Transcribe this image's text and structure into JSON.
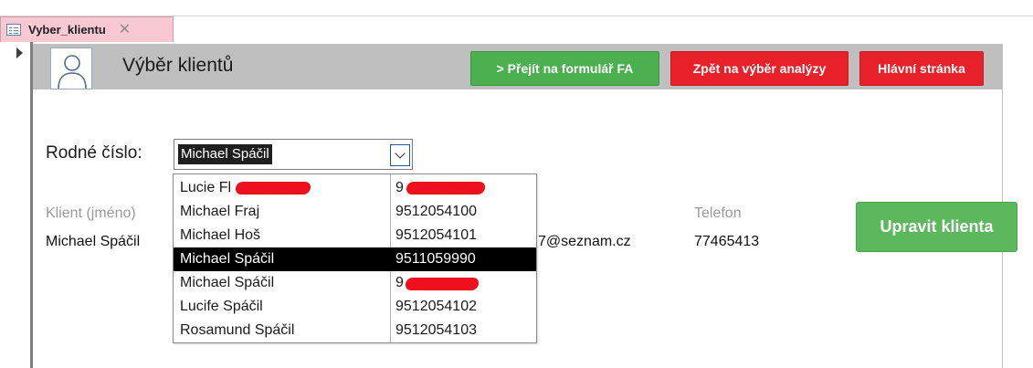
{
  "tab": {
    "title": "Vyber_klientu",
    "close_glyph": "✕"
  },
  "header": {
    "title": "Výběr klientů",
    "buttons": {
      "form_fa": "> Přejít na formulář FA",
      "back_analysis": "Zpět na výběr analýzy",
      "main_page": "Hlávní stránka"
    }
  },
  "form": {
    "rodne_cislo_label": "Rodné číslo:",
    "combo_value": "Michael Spáčil",
    "client_label": "Klient (jméno)",
    "client_value": "Michael Spáčil",
    "email_value_partial": "7@seznam.cz",
    "phone_label": "Telefon",
    "phone_value": "77465413",
    "edit_button": "Upravit klienta"
  },
  "dropdown": {
    "rows": [
      {
        "name": "Lucie Fl",
        "rc": "9",
        "selected": false
      },
      {
        "name": "Michael Fraj",
        "rc": "9512054100",
        "selected": false
      },
      {
        "name": "Michael Hoš",
        "rc": "9512054101",
        "selected": false
      },
      {
        "name": "Michael Spáčil",
        "rc": "9511059990",
        "selected": true
      },
      {
        "name": "Michael Spáčil",
        "rc": "9",
        "selected": false
      },
      {
        "name": "Lucife Spáčil",
        "rc": "9512054102",
        "selected": false
      },
      {
        "name": "Rosamund Spáčil",
        "rc": "9512054103",
        "selected": false
      }
    ]
  },
  "colors": {
    "green_button": "#4caf50",
    "red_button": "#e8202a",
    "header_band": "#bfbfbf",
    "tab_bg": "#f8c9d3",
    "redaction": "#ee0f1f"
  },
  "icons": [
    "form-icon",
    "close-icon",
    "user-icon",
    "record-selector-icon",
    "chevron-down-icon"
  ]
}
